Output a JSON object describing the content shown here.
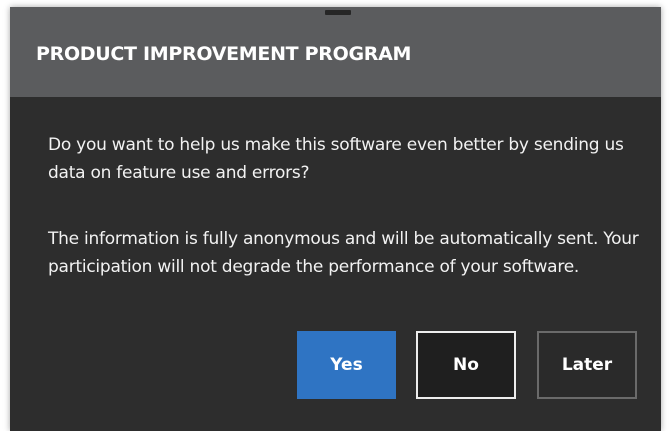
{
  "dialog": {
    "title": "PRODUCT IMPROVEMENT PROGRAM",
    "question": "Do you want to help us make this software even better by sending us data on feature use and errors?",
    "info": "The information is fully anonymous and will be automatically sent. Your participation will not degrade the performance of your software.",
    "buttons": {
      "yes": "Yes",
      "no": "No",
      "later": "Later"
    }
  },
  "colors": {
    "header": "#5b5c5e",
    "body": "#2d2d2d",
    "accent": "#2f74c3"
  }
}
